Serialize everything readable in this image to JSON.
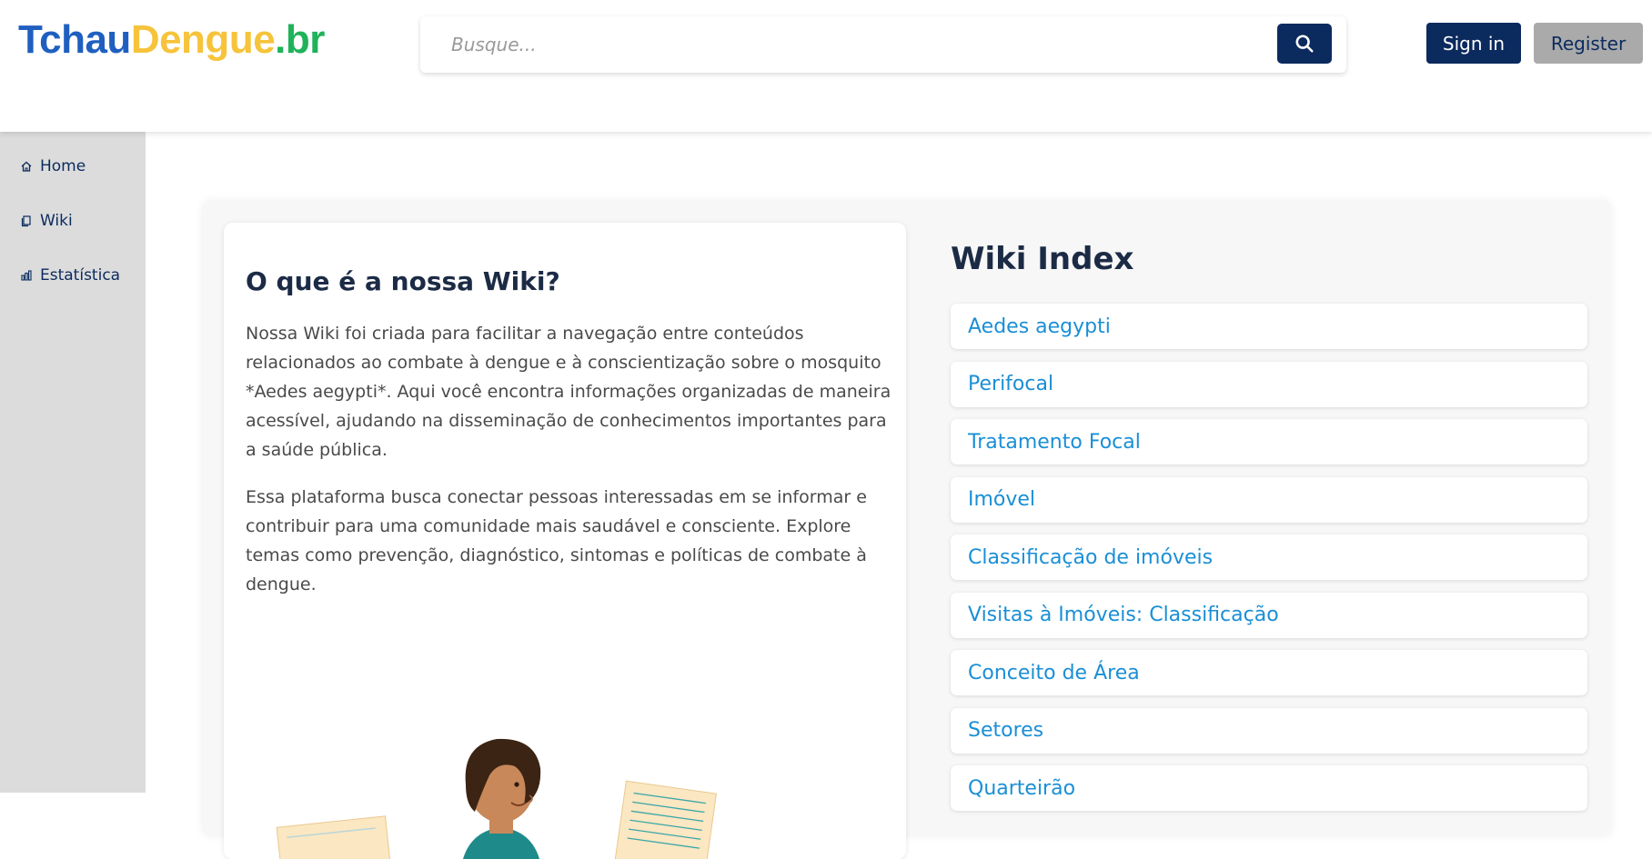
{
  "header": {
    "logo": {
      "part1": "Tchau",
      "part2": "Dengue",
      "part3": ".br"
    },
    "search": {
      "placeholder": "Busque..."
    },
    "signin_label": "Sign in",
    "register_label": "Register"
  },
  "sidebar": {
    "items": [
      {
        "label": "Home",
        "icon": "home-icon"
      },
      {
        "label": "Wiki",
        "icon": "document-icon"
      },
      {
        "label": "Estatística",
        "icon": "bar-chart-icon"
      }
    ]
  },
  "about": {
    "title": "O que é a nossa Wiki?",
    "paragraph1": "Nossa Wiki foi criada para facilitar a navegação entre conteúdos relacionados ao combate à dengue e à conscientização sobre o mosquito *Aedes aegypti*. Aqui você encontra informações organizadas de maneira acessível, ajudando na disseminação de conhecimentos importantes para a saúde pública.",
    "paragraph2": "Essa plataforma busca conectar pessoas interessadas em se informar e contribuir para uma comunidade mais saudável e consciente. Explore temas como prevenção, diagnóstico, sintomas e políticas de combate à dengue."
  },
  "wiki_index": {
    "title": "Wiki Index",
    "items": [
      "Aedes aegypti",
      "Perifocal",
      "Tratamento Focal",
      "Imóvel",
      "Classificação de imóveis",
      "Visitas à Imóveis: Classificação",
      "Conceito de Área",
      "Setores",
      "Quarteirão"
    ]
  },
  "colors": {
    "primary": "#0b2a5e",
    "link": "#1a8fd6",
    "logo_blue": "#1f5fc0",
    "logo_yellow": "#f6c33a",
    "logo_green": "#1fb25a"
  }
}
